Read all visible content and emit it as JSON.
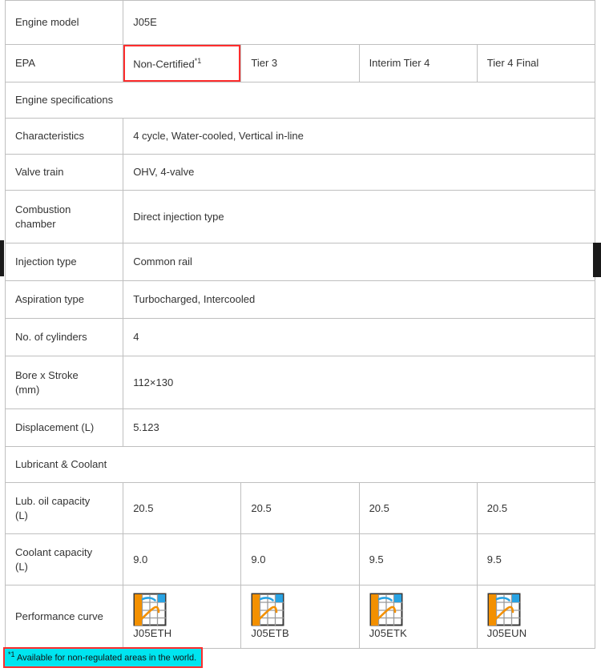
{
  "table": {
    "rows": [
      {
        "type": "kv",
        "label": "Engine model",
        "value": "J05E"
      },
      {
        "type": "epa",
        "label": "EPA",
        "options": [
          {
            "text": "Non-Certified",
            "footnote_mark": "*1",
            "selected": true
          },
          {
            "text": "Tier 3",
            "footnote_mark": "",
            "selected": false
          },
          {
            "text": "Interim Tier 4",
            "footnote_mark": "",
            "selected": false
          },
          {
            "text": "Tier 4 Final",
            "footnote_mark": "",
            "selected": false
          }
        ]
      },
      {
        "type": "section",
        "label": "Engine specifications"
      },
      {
        "type": "kv",
        "label": "Characteristics",
        "value": "4 cycle, Water-cooled, Vertical in-line"
      },
      {
        "type": "kv",
        "label": "Valve train",
        "value": "OHV, 4-valve"
      },
      {
        "type": "kv",
        "label": "Combustion chamber",
        "value": "Direct injection type"
      },
      {
        "type": "kv",
        "label": "Injection type",
        "value": "Common rail"
      },
      {
        "type": "kv",
        "label": "Aspiration type",
        "value": "Turbocharged, Intercooled"
      },
      {
        "type": "kv",
        "label": "No. of cylinders",
        "value": "4"
      },
      {
        "type": "kv",
        "label": "Bore x Stroke (mm)",
        "value": "112×130"
      },
      {
        "type": "kv",
        "label": "Displacement (L)",
        "value": "5.123"
      },
      {
        "type": "section",
        "label": "Lubricant & Coolant"
      },
      {
        "type": "multi",
        "label": "Lub. oil capacity (L)",
        "values": [
          "20.5",
          "20.5",
          "20.5",
          "20.5"
        ]
      },
      {
        "type": "multi",
        "label": "Coolant capacity (L)",
        "values": [
          "9.0",
          "9.0",
          "9.5",
          "9.5"
        ]
      },
      {
        "type": "curves",
        "label": "Performance curve",
        "values": [
          "J05ETH",
          "J05ETB",
          "J05ETK",
          "J05EUN"
        ]
      }
    ],
    "labels": {
      "engine_model": "Engine model",
      "epa": "EPA",
      "engine_specifications": "Engine specifications",
      "characteristics": "Characteristics",
      "valve_train": "Valve train",
      "combustion_chamber_line1": "Combustion",
      "combustion_chamber_line2": "chamber",
      "injection_type": "Injection type",
      "aspiration_type": "Aspiration type",
      "no_of_cylinders": "No. of cylinders",
      "bore_stroke_line1": "Bore x Stroke",
      "bore_stroke_line2": "(mm)",
      "displacement": "Displacement (L)",
      "lubricant_coolant": "Lubricant & Coolant",
      "lub_oil_line1": "Lub. oil capacity",
      "lub_oil_line2": "(L)",
      "coolant_line1": "Coolant capacity",
      "coolant_line2": "(L)",
      "performance_curve": "Performance curve"
    },
    "values": {
      "engine_model": "J05E",
      "characteristics": "4 cycle, Water-cooled, Vertical in-line",
      "valve_train": "OHV, 4-valve",
      "combustion_chamber": "Direct injection type",
      "injection_type": "Common rail",
      "aspiration_type": "Turbocharged, Intercooled",
      "no_of_cylinders": "4",
      "bore_stroke": "112×130",
      "displacement": "5.123"
    },
    "epa_options": {
      "o1_text": "Non-Certified",
      "o1_mark": "*1",
      "o2_text": "Tier 3",
      "o3_text": "Interim Tier 4",
      "o4_text": "Tier 4 Final"
    },
    "lub_oil": {
      "c1": "20.5",
      "c2": "20.5",
      "c3": "20.5",
      "c4": "20.5"
    },
    "coolant": {
      "c1": "9.0",
      "c2": "9.0",
      "c3": "9.5",
      "c4": "9.5"
    },
    "curves": {
      "c1": "J05ETH",
      "c2": "J05ETB",
      "c3": "J05ETK",
      "c4": "J05EUN"
    }
  },
  "footnote": {
    "mark": "*1",
    "text": "Available for non-regulated areas in the world."
  },
  "colors": {
    "header_dark": "#4d4d4d",
    "highlight_cyan": "#00e5f0",
    "highlight_border_red": "#ff2d2d",
    "grid_line": "#bfbfbf",
    "text_dark": "#333333",
    "curve_orange": "#f39000",
    "curve_blue": "#29a3e3"
  }
}
